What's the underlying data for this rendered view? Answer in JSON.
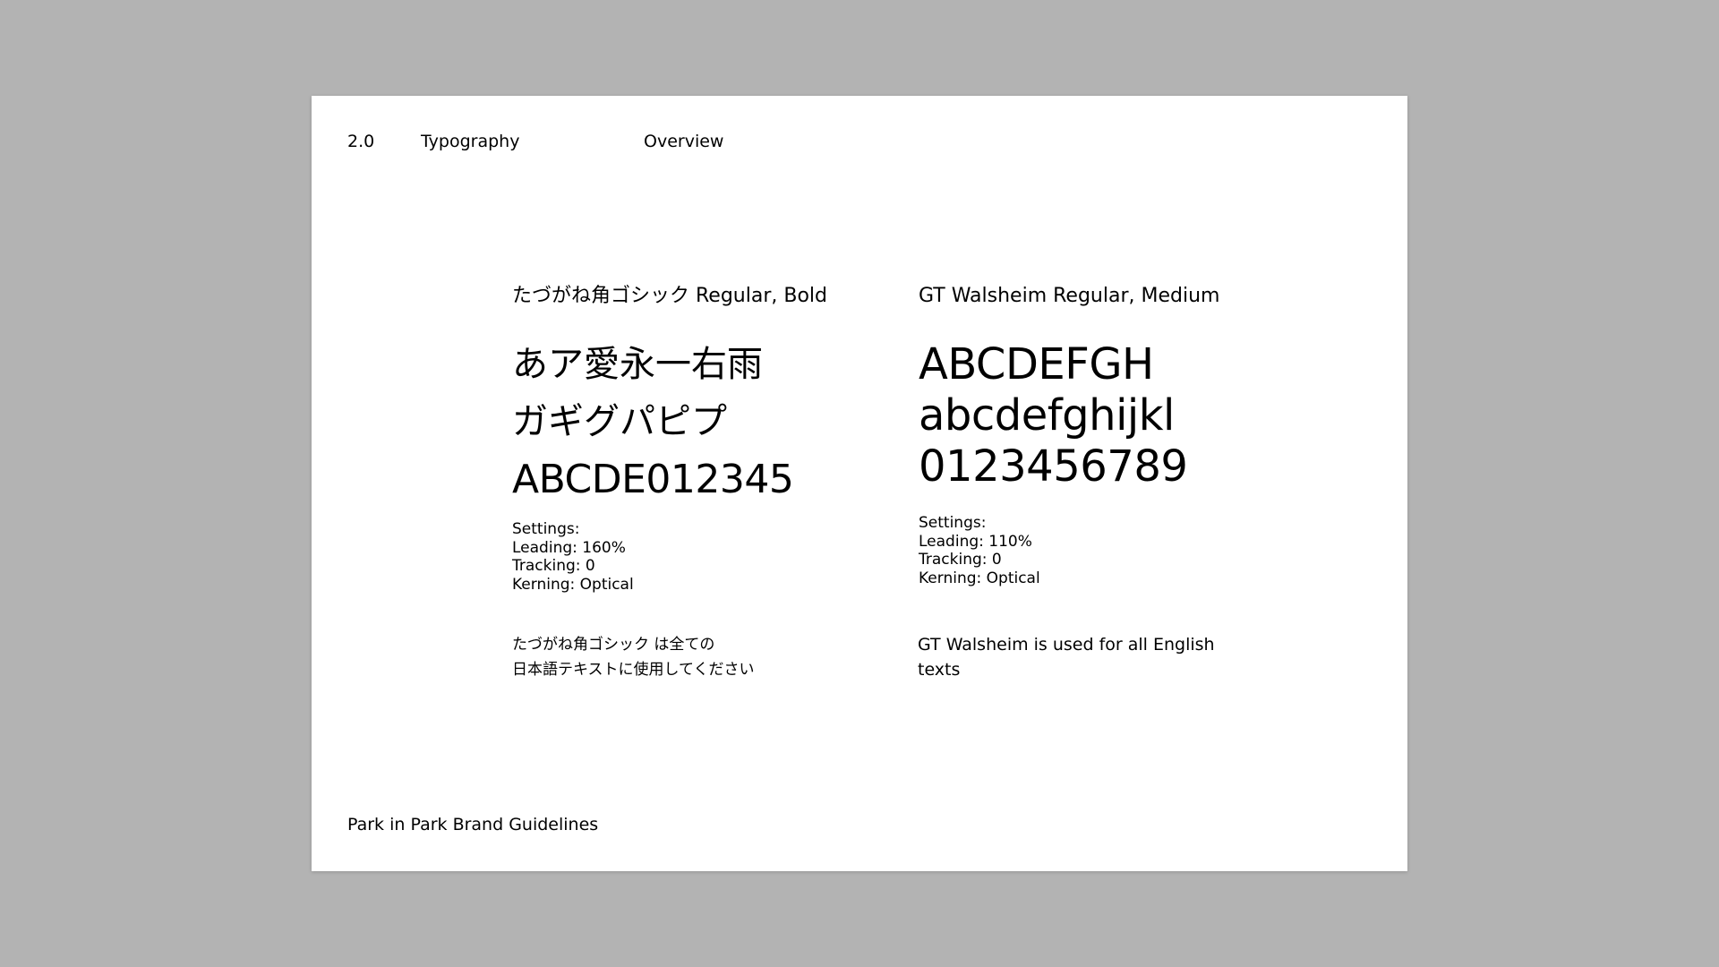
{
  "header": {
    "section_number": "2.0",
    "section_title": "Typography",
    "page_title": "Overview"
  },
  "japanese_font": {
    "name": "たづがね角ゴシック Regular, Bold",
    "samples": [
      "あア愛永一右雨",
      "ガギグパピプ",
      "ABCDE012345"
    ],
    "settings": [
      "Settings:",
      "Leading: 160%",
      "Tracking: 0",
      "Kerning: Optical"
    ],
    "note": [
      "たづがね角ゴシック は全ての",
      "日本語テキストに使用してください"
    ]
  },
  "english_font": {
    "name": "GT Walsheim Regular, Medium",
    "samples": [
      "ABCDEFGH",
      "abcdefghijkl",
      "0123456789"
    ],
    "settings": [
      "Settings:",
      "Leading: 110%",
      "Tracking: 0",
      "Kerning: Optical"
    ],
    "note": [
      "GT Walsheim is used for all English",
      "texts"
    ]
  },
  "footer": {
    "text": "Park in Park Brand Guidelines"
  },
  "colors": {
    "background": "#b3b3b3",
    "page": "#ffffff",
    "text": "#000000"
  }
}
